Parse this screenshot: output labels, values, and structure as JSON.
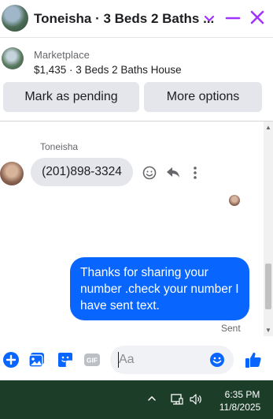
{
  "header": {
    "title": "Toneisha · 3 Beds 2 Baths ...",
    "accent_color": "#a033ff",
    "icons": [
      "avatar",
      "chevron-down-icon",
      "minimize-icon",
      "close-icon"
    ]
  },
  "listing": {
    "source": "Marketplace",
    "description": "$1,435 · 3 Beds 2 Baths House"
  },
  "actions": {
    "pending_label": "Mark as pending",
    "more_label": "More options"
  },
  "conversation": {
    "sender_name": "Toneisha",
    "incoming_message": "(201)898-3324",
    "outgoing_message": "Thanks for sharing your number .check your number I have sent text.",
    "status": "Sent",
    "outgoing_color": "#0866ff"
  },
  "composer": {
    "placeholder": "Aa",
    "gif_label": "GIF",
    "brand_color": "#0866ff"
  },
  "taskbar": {
    "time": "6:35 PM",
    "date": "11/8/2025"
  }
}
